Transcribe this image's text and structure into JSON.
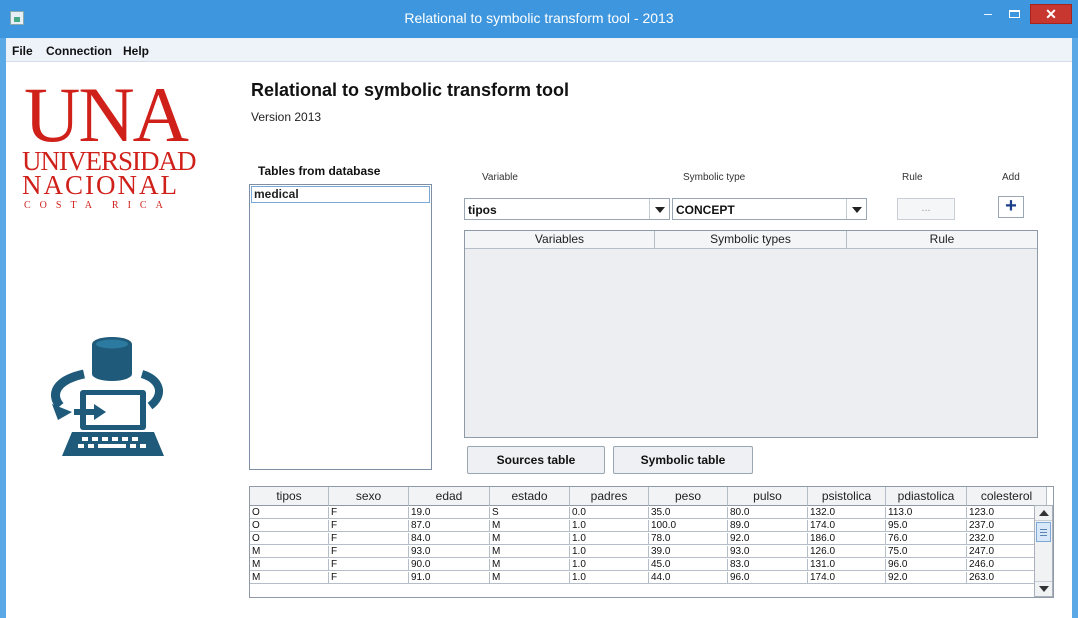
{
  "window": {
    "title": "Relational to symbolic transform tool - 2013",
    "close_glyph": "✕",
    "minimize_glyph": "–"
  },
  "menu": [
    "File",
    "Connection",
    "Help"
  ],
  "logo": {
    "una": "UNA",
    "universidad": "UNIVERSIDAD",
    "nacional": "NACIONAL",
    "costa_rica": "COSTA RICA",
    "color": "#d0201a"
  },
  "header": {
    "title": "Relational to symbolic transform tool",
    "version": "Version 2013"
  },
  "tables_panel": {
    "label": "Tables from database",
    "items": [
      "medical"
    ]
  },
  "controls": {
    "variable_label": "Variable",
    "symbolic_type_label": "Symbolic type",
    "rule_label": "Rule",
    "add_label": "Add",
    "variable_value": "tipos",
    "symbolic_type_value": "CONCEPT",
    "rule_button": "...",
    "add_button": "+"
  },
  "variables_table": {
    "columns": [
      "Variables",
      "Symbolic types",
      "Rule"
    ],
    "rows": []
  },
  "buttons": {
    "sources_table": "Sources table",
    "symbolic_table": "Symbolic table"
  },
  "source_table": {
    "columns": [
      "tipos",
      "sexo",
      "edad",
      "estado",
      "padres",
      "peso",
      "pulso",
      "psistolica",
      "pdiastolica",
      "colesterol"
    ],
    "rows": [
      [
        "O",
        "F",
        "19.0",
        "S",
        "0.0",
        "35.0",
        "80.0",
        "132.0",
        "113.0",
        "123.0"
      ],
      [
        "O",
        "F",
        "87.0",
        "M",
        "1.0",
        "100.0",
        "89.0",
        "174.0",
        "95.0",
        "237.0"
      ],
      [
        "O",
        "F",
        "84.0",
        "M",
        "1.0",
        "78.0",
        "92.0",
        "186.0",
        "76.0",
        "232.0"
      ],
      [
        "M",
        "F",
        "93.0",
        "M",
        "1.0",
        "39.0",
        "93.0",
        "126.0",
        "75.0",
        "247.0"
      ],
      [
        "M",
        "F",
        "90.0",
        "M",
        "1.0",
        "45.0",
        "83.0",
        "131.0",
        "96.0",
        "246.0"
      ],
      [
        "M",
        "F",
        "91.0",
        "M",
        "1.0",
        "44.0",
        "96.0",
        "174.0",
        "92.0",
        "263.0"
      ]
    ]
  },
  "colors": {
    "title_bar": "#3e97de",
    "close_button": "#c7372f",
    "icon_blue": "#1f5a7a"
  }
}
